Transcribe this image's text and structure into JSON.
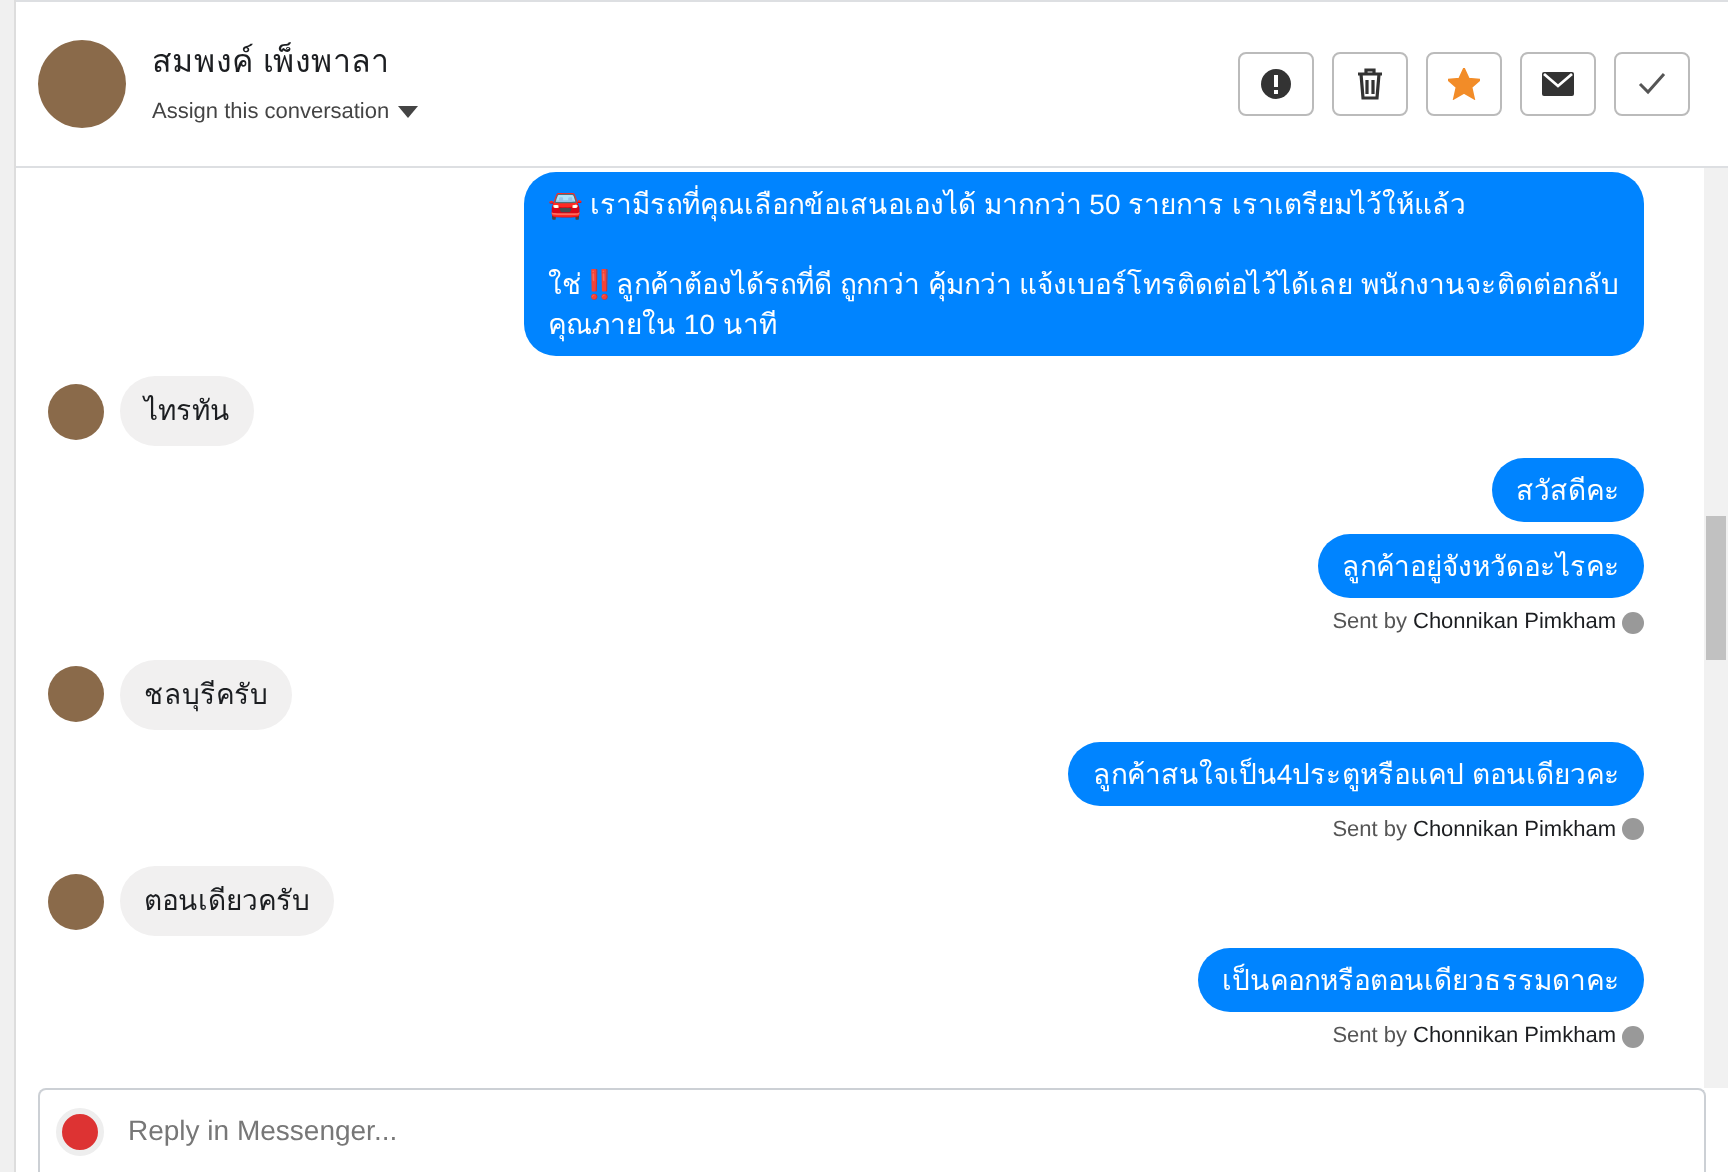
{
  "header": {
    "name": "สมพงค์ เพ็งพาลา",
    "assign": "Assign this conversation",
    "actions": [
      {
        "kind": "spam"
      },
      {
        "kind": "delete"
      },
      {
        "kind": "star",
        "on": true
      },
      {
        "kind": "unread"
      },
      {
        "kind": "done"
      }
    ]
  },
  "messages": [
    {
      "kind": "outgoing",
      "text": "🚘 เรามีรถที่คุณเลือกข้อเสนอเองได้ มากกว่า 50 รายการ เราเตรียมไว้ให้แล้ว\n\nใช่‼️ลูกค้าต้องได้รถที่ดี ถูกกว่า คุ้มกว่า แจ้งเบอร์โทรติดต่อไว้ได้เลย พนักงานจะติดต่อกลับคุณภายใน 10 นาที"
    },
    {
      "kind": "incoming",
      "text": "ไทรทัน"
    },
    {
      "kind": "outgoing",
      "text": "สวัสดีคะ"
    },
    {
      "kind": "outgoing",
      "text": "ลูกค้าอยู่จังหวัดอะไรคะ",
      "sent_by": "Sent by",
      "sender": "Chonnikan Pimkham"
    },
    {
      "kind": "incoming",
      "text": "ชลบุรีครับ"
    },
    {
      "kind": "outgoing",
      "text": "ลูกค้าสนใจเป็น4ประตูหรือแคป ตอนเดียวคะ",
      "sent_by": "Sent by",
      "sender": "Chonnikan Pimkham"
    },
    {
      "kind": "incoming",
      "text": "ตอนเดียวครับ"
    },
    {
      "kind": "outgoing",
      "text": "เป็นคอกหรือตอนเดียวธรรมดาคะ",
      "sent_by": "Sent by",
      "sender": "Chonnikan Pimkham"
    }
  ],
  "reply": {
    "placeholder": "Reply in Messenger..."
  }
}
